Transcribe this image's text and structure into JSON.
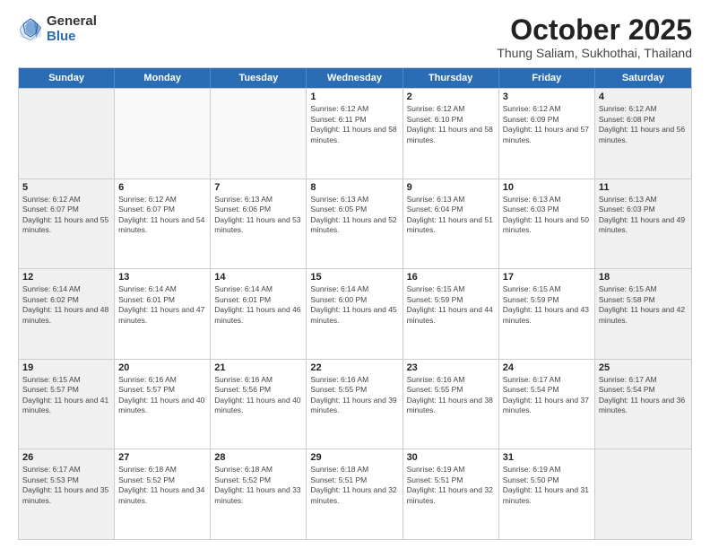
{
  "logo": {
    "general": "General",
    "blue": "Blue"
  },
  "header": {
    "month": "October 2025",
    "location": "Thung Saliam, Sukhothai, Thailand"
  },
  "weekdays": [
    "Sunday",
    "Monday",
    "Tuesday",
    "Wednesday",
    "Thursday",
    "Friday",
    "Saturday"
  ],
  "rows": [
    [
      {
        "day": "",
        "empty": true
      },
      {
        "day": "",
        "empty": true
      },
      {
        "day": "",
        "empty": true
      },
      {
        "day": "1",
        "sunrise": "6:12 AM",
        "sunset": "6:11 PM",
        "daylight": "11 hours and 58 minutes."
      },
      {
        "day": "2",
        "sunrise": "6:12 AM",
        "sunset": "6:10 PM",
        "daylight": "11 hours and 58 minutes."
      },
      {
        "day": "3",
        "sunrise": "6:12 AM",
        "sunset": "6:09 PM",
        "daylight": "11 hours and 57 minutes."
      },
      {
        "day": "4",
        "sunrise": "6:12 AM",
        "sunset": "6:08 PM",
        "daylight": "11 hours and 56 minutes."
      }
    ],
    [
      {
        "day": "5",
        "sunrise": "6:12 AM",
        "sunset": "6:07 PM",
        "daylight": "11 hours and 55 minutes."
      },
      {
        "day": "6",
        "sunrise": "6:12 AM",
        "sunset": "6:07 PM",
        "daylight": "11 hours and 54 minutes."
      },
      {
        "day": "7",
        "sunrise": "6:13 AM",
        "sunset": "6:06 PM",
        "daylight": "11 hours and 53 minutes."
      },
      {
        "day": "8",
        "sunrise": "6:13 AM",
        "sunset": "6:05 PM",
        "daylight": "11 hours and 52 minutes."
      },
      {
        "day": "9",
        "sunrise": "6:13 AM",
        "sunset": "6:04 PM",
        "daylight": "11 hours and 51 minutes."
      },
      {
        "day": "10",
        "sunrise": "6:13 AM",
        "sunset": "6:03 PM",
        "daylight": "11 hours and 50 minutes."
      },
      {
        "day": "11",
        "sunrise": "6:13 AM",
        "sunset": "6:03 PM",
        "daylight": "11 hours and 49 minutes."
      }
    ],
    [
      {
        "day": "12",
        "sunrise": "6:14 AM",
        "sunset": "6:02 PM",
        "daylight": "11 hours and 48 minutes."
      },
      {
        "day": "13",
        "sunrise": "6:14 AM",
        "sunset": "6:01 PM",
        "daylight": "11 hours and 47 minutes."
      },
      {
        "day": "14",
        "sunrise": "6:14 AM",
        "sunset": "6:01 PM",
        "daylight": "11 hours and 46 minutes."
      },
      {
        "day": "15",
        "sunrise": "6:14 AM",
        "sunset": "6:00 PM",
        "daylight": "11 hours and 45 minutes."
      },
      {
        "day": "16",
        "sunrise": "6:15 AM",
        "sunset": "5:59 PM",
        "daylight": "11 hours and 44 minutes."
      },
      {
        "day": "17",
        "sunrise": "6:15 AM",
        "sunset": "5:59 PM",
        "daylight": "11 hours and 43 minutes."
      },
      {
        "day": "18",
        "sunrise": "6:15 AM",
        "sunset": "5:58 PM",
        "daylight": "11 hours and 42 minutes."
      }
    ],
    [
      {
        "day": "19",
        "sunrise": "6:15 AM",
        "sunset": "5:57 PM",
        "daylight": "11 hours and 41 minutes."
      },
      {
        "day": "20",
        "sunrise": "6:16 AM",
        "sunset": "5:57 PM",
        "daylight": "11 hours and 40 minutes."
      },
      {
        "day": "21",
        "sunrise": "6:16 AM",
        "sunset": "5:56 PM",
        "daylight": "11 hours and 40 minutes."
      },
      {
        "day": "22",
        "sunrise": "6:16 AM",
        "sunset": "5:55 PM",
        "daylight": "11 hours and 39 minutes."
      },
      {
        "day": "23",
        "sunrise": "6:16 AM",
        "sunset": "5:55 PM",
        "daylight": "11 hours and 38 minutes."
      },
      {
        "day": "24",
        "sunrise": "6:17 AM",
        "sunset": "5:54 PM",
        "daylight": "11 hours and 37 minutes."
      },
      {
        "day": "25",
        "sunrise": "6:17 AM",
        "sunset": "5:54 PM",
        "daylight": "11 hours and 36 minutes."
      }
    ],
    [
      {
        "day": "26",
        "sunrise": "6:17 AM",
        "sunset": "5:53 PM",
        "daylight": "11 hours and 35 minutes."
      },
      {
        "day": "27",
        "sunrise": "6:18 AM",
        "sunset": "5:52 PM",
        "daylight": "11 hours and 34 minutes."
      },
      {
        "day": "28",
        "sunrise": "6:18 AM",
        "sunset": "5:52 PM",
        "daylight": "11 hours and 33 minutes."
      },
      {
        "day": "29",
        "sunrise": "6:18 AM",
        "sunset": "5:51 PM",
        "daylight": "11 hours and 32 minutes."
      },
      {
        "day": "30",
        "sunrise": "6:19 AM",
        "sunset": "5:51 PM",
        "daylight": "11 hours and 32 minutes."
      },
      {
        "day": "31",
        "sunrise": "6:19 AM",
        "sunset": "5:50 PM",
        "daylight": "11 hours and 31 minutes."
      },
      {
        "day": "",
        "empty": true
      }
    ]
  ]
}
